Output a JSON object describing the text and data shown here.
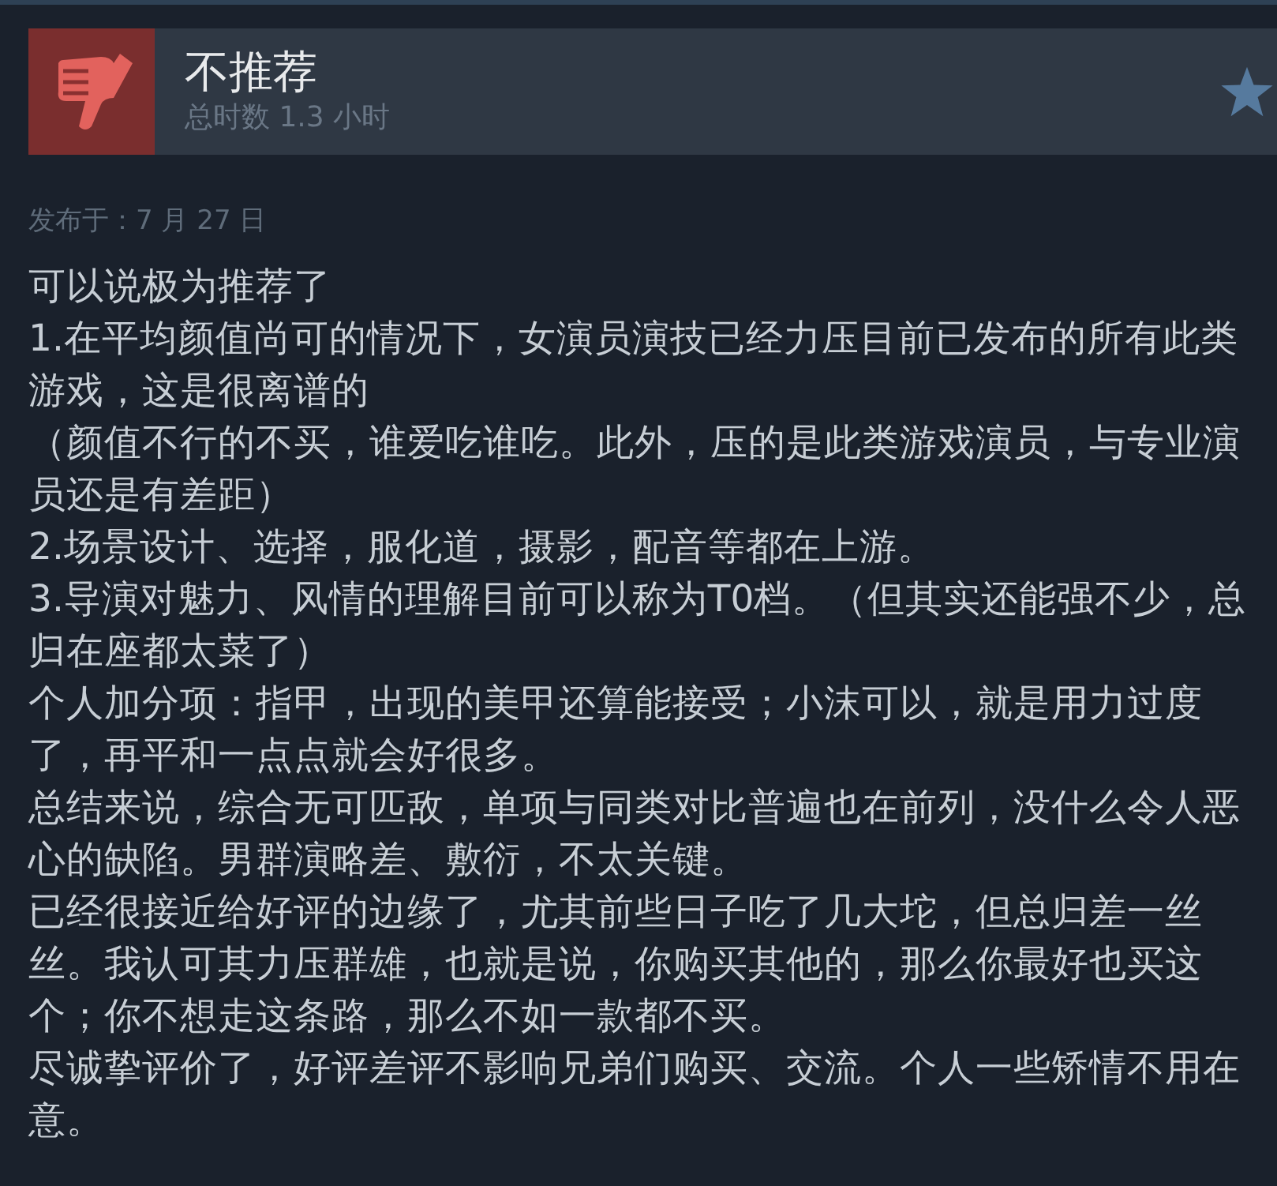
{
  "review": {
    "verdict": "不推荐",
    "recommended": false,
    "playtime": "总时数 1.3 小时",
    "posted": "发布于：7 月 27 日",
    "paragraphs": [
      "可以说极为推荐了",
      "1.在平均颜值尚可的情况下，女演员演技已经力压目前已发布的所有此类游戏，这是很离谱的",
      "（颜值不行的不买，谁爱吃谁吃。此外，压的是此类游戏演员，与专业演员还是有差距）",
      "2.场景设计、选择，服化道，摄影，配音等都在上游。",
      "3.导演对魅力、风情的理解目前可以称为T0档。（但其实还能强不少，总归在座都太菜了）",
      "个人加分项：指甲，出现的美甲还算能接受；小沫可以，就是用力过度了，再平和一点点就会好很多。",
      "总结来说，综合无可匹敌，单项与同类对比普遍也在前列，没什么令人恶心的缺陷。男群演略差、敷衍，不太关键。",
      "已经很接近给好评的边缘了，尤其前些日子吃了几大坨，但总归差一丝丝。我认可其力压群雄，也就是说，你购买其他的，那么你最好也买这个；你不想走这条路，那么不如一款都不买。",
      "尽诚挚评价了，好评差评不影响兄弟们购买、交流。个人一些矫情不用在意。"
    ]
  }
}
